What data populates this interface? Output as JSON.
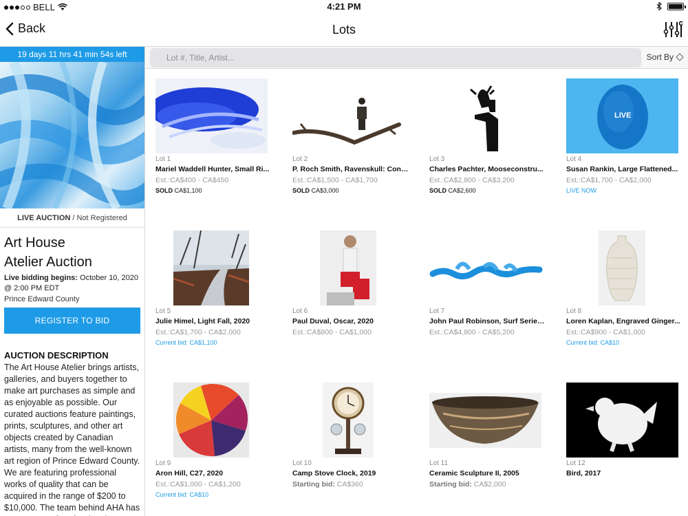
{
  "status_bar": {
    "carrier": "BELL",
    "time": "4:21 PM"
  },
  "nav": {
    "back_label": "Back",
    "title": "Lots"
  },
  "sidebar": {
    "countdown": "19 days 11 hrs 41 min 54s left",
    "live_label": "LIVE AUCTION",
    "registration_status": " / Not Registered",
    "title_line1": "Art House",
    "title_line2": "Atelier Auction",
    "bidding_label": "Live bidding begins:",
    "bidding_date": " October 10, 2020 @ 2:00 PM EDT",
    "location": "Prince Edward County",
    "register_button": "REGISTER TO BID",
    "description_heading": "AUCTION DESCRIPTION",
    "description": "The Art House Atelier brings artists, galleries, and buyers together to make art purchases as simple and as enjoyable as possible. Our curated auctions feature paintings, prints, sculptures, and other art objects created by Canadian artists, many from the well-known art region of Prince Edward County. We are featuring professional works of quality that can be acquired in the range of $200 to $10,000. The team behind AHA has many years of professional experience in the"
  },
  "search": {
    "placeholder": "Lot #, Title, Artist...",
    "sort_label": "Sort By"
  },
  "lots": [
    {
      "lot": "Lot 1",
      "title": "Mariel Waddell Hunter, Small Ri...",
      "estimate": "Est.:CA$400 - CA$450",
      "status_label": "SOLD",
      "status_value": " CA$1,100",
      "status_type": "sold"
    },
    {
      "lot": "Lot 2",
      "title": "P. Roch Smith, Ravenskull: Cont...",
      "estimate": "Est.:CA$1,500 - CA$1,700",
      "status_label": "SOLD",
      "status_value": " CA$3,000",
      "status_type": "sold"
    },
    {
      "lot": "Lot 3",
      "title": "Charles Pachter, Mooseconstru...",
      "estimate": "Est.:CA$2,800 - CA$3,200",
      "status_label": "SOLD",
      "status_value": " CA$2,600",
      "status_type": "sold"
    },
    {
      "lot": "Lot 4",
      "title": "Susan Rankin, Large Flattened...",
      "estimate": "Est.:CA$1,700 - CA$2,000",
      "status_label": "LIVE NOW",
      "status_value": "",
      "status_type": "live",
      "overlay": "LIVE"
    },
    {
      "lot": "Lot 5",
      "title": "Julie Himel, Light Fall, 2020",
      "estimate": "Est.:CA$1,700 - CA$2,000",
      "status_label": "Current bid:",
      "status_value": " CA$1,100",
      "status_type": "bid"
    },
    {
      "lot": "Lot 6",
      "title": "Paul Duval, Oscar, 2020",
      "estimate": "Est.:CA$800 - CA$1,000",
      "status_label": "",
      "status_value": "",
      "status_type": "none"
    },
    {
      "lot": "Lot 7",
      "title": "John Paul Robinson, Surf Series...",
      "estimate": "Est.:CA$4,800 - CA$5,200",
      "status_label": "",
      "status_value": "",
      "status_type": "none"
    },
    {
      "lot": "Lot 8",
      "title": "Loren Kaplan, Engraved Ginger...",
      "estimate": "Est.:CA$900 - CA$1,000",
      "status_label": "Current bid:",
      "status_value": " CA$10",
      "status_type": "bid"
    },
    {
      "lot": "Lot 9",
      "title": "Aron Hill, C27, 2020",
      "estimate": "Est.:CA$1,000 - CA$1,200",
      "status_label": "Current bid:",
      "status_value": " CA$10",
      "status_type": "bid"
    },
    {
      "lot": "Lot 10",
      "title": "Camp Stove Clock, 2019",
      "estimate_label": "Starting bid:",
      "estimate": " CA$360",
      "status_label": "",
      "status_value": "",
      "status_type": "none"
    },
    {
      "lot": "Lot 11",
      "title": "Ceramic Sculpture II, 2005",
      "estimate_label": "Starting bid:",
      "estimate": " CA$2,000",
      "status_label": "",
      "status_value": "",
      "status_type": "none"
    },
    {
      "lot": "Lot 12",
      "title": "Bird, 2017",
      "estimate": "",
      "status_label": "",
      "status_value": "",
      "status_type": "none"
    }
  ]
}
